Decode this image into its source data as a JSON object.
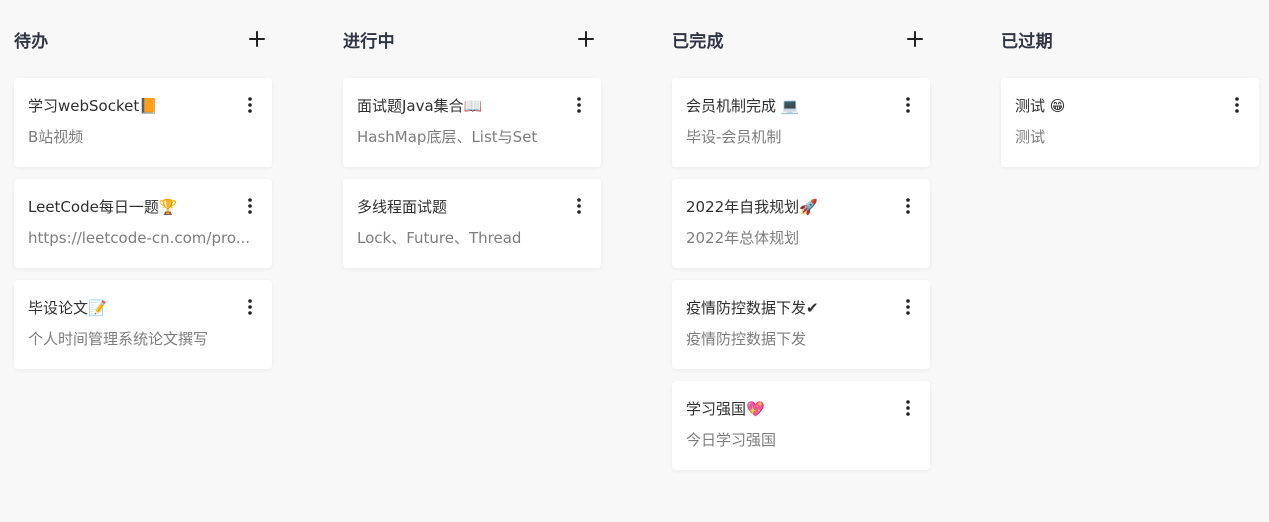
{
  "icons": {
    "add": "plus-icon",
    "more": "more-vertical-icon"
  },
  "colors": {
    "background": "#f8f8f8",
    "card": "#ffffff",
    "title": "#2f3542",
    "desc": "#7d7d7d"
  },
  "columns": [
    {
      "title": "待办",
      "has_add": true,
      "cards": [
        {
          "title": "学习webSocket📙",
          "desc": "B站视频"
        },
        {
          "title": "LeetCode每日一题🏆",
          "desc": "https://leetcode-cn.com/pro..."
        },
        {
          "title": "毕设论文📝",
          "desc": "个人时间管理系统论文撰写"
        }
      ]
    },
    {
      "title": "进行中",
      "has_add": true,
      "cards": [
        {
          "title": "面试题Java集合📖",
          "desc": "HashMap底层、List与Set"
        },
        {
          "title": "多线程面试题",
          "desc": "Lock、Future、Thread"
        }
      ]
    },
    {
      "title": "已完成",
      "has_add": true,
      "cards": [
        {
          "title": "会员机制完成 💻",
          "desc": "毕设-会员机制"
        },
        {
          "title": "2022年自我规划🚀",
          "desc": "2022年总体规划"
        },
        {
          "title": "疫情防控数据下发✔",
          "desc": "疫情防控数据下发"
        },
        {
          "title": "学习强国💖",
          "desc": "今日学习强国"
        }
      ]
    },
    {
      "title": "已过期",
      "has_add": false,
      "cards": [
        {
          "title": "测试 😁",
          "desc": "测试"
        }
      ]
    }
  ]
}
